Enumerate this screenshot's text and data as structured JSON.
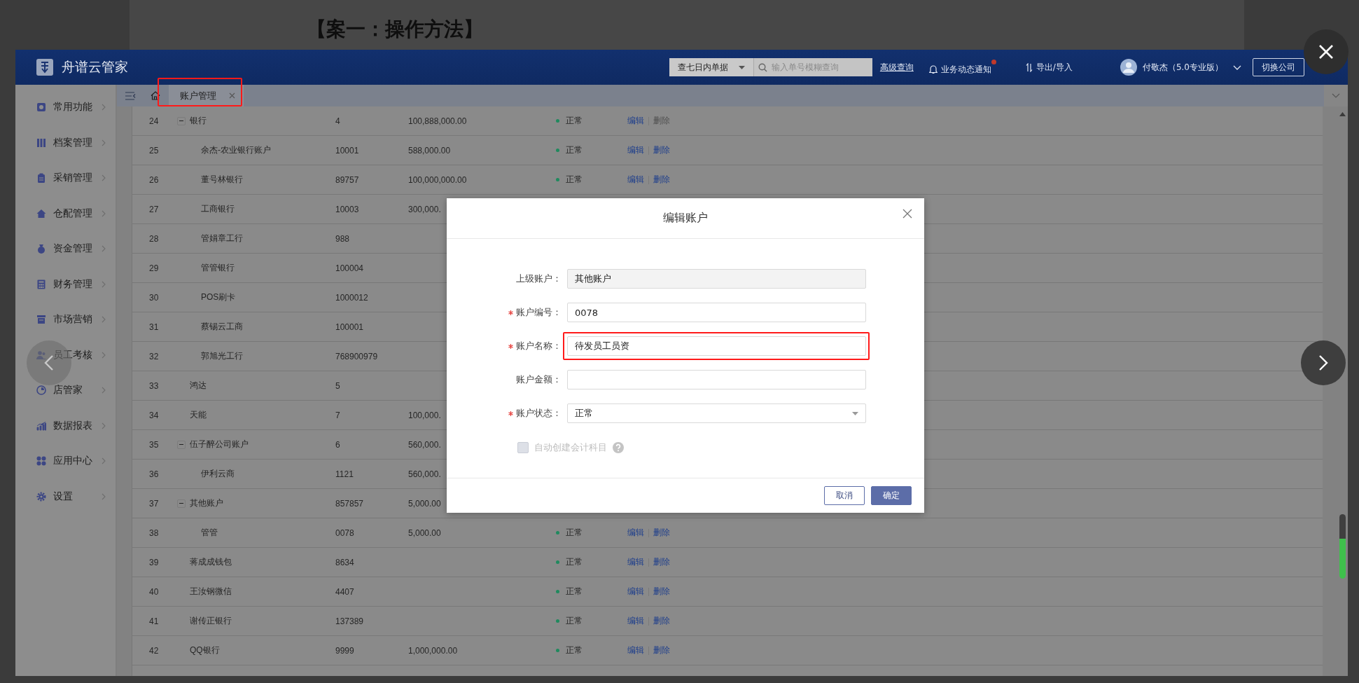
{
  "document": {
    "heading": "【案一：操作方法】"
  },
  "app": {
    "header": {
      "brand": "舟谱云管家",
      "range_select": "查七日内单据",
      "search": {
        "placeholder": "输入单号模糊查询"
      },
      "advanced_link": "高级查询",
      "notifications": {
        "label": "业务动态通知",
        "unread": true
      },
      "export_import": "导出/导入",
      "user": "付敬杰（5.0专业版）",
      "switch_button": "切换公司"
    },
    "sidebar": {
      "items": [
        {
          "label": "常用功能"
        },
        {
          "label": "档案管理"
        },
        {
          "label": "采销管理"
        },
        {
          "label": "仓配管理"
        },
        {
          "label": "资金管理"
        },
        {
          "label": "财务管理"
        },
        {
          "label": "市场营销"
        },
        {
          "label": "员工考核"
        },
        {
          "label": "店管家"
        },
        {
          "label": "数据报表"
        },
        {
          "label": "应用中心"
        },
        {
          "label": "设置"
        }
      ]
    },
    "tabs": [
      {
        "label": "账户管理",
        "selected": true,
        "highlighted": true
      }
    ],
    "table": {
      "rows": [
        {
          "no": "24",
          "name": "银行",
          "code": "4",
          "amount": "100,888,000.00",
          "status": "正常",
          "actions": [
            {
              "label": "编辑",
              "disabled": false
            },
            {
              "label": "删除",
              "disabled": true
            }
          ],
          "expanded": true,
          "children": [
            {
              "no": "25",
              "name": "余杰-农业银行账户",
              "code": "10001",
              "amount": "588,000.00",
              "status": "正常",
              "actions": [
                {
                  "label": "编辑",
                  "disabled": false
                },
                {
                  "label": "删除",
                  "disabled": false
                }
              ]
            },
            {
              "no": "26",
              "name": "董号林银行",
              "code": "89757",
              "amount": "100,000,000.00",
              "status": "正常",
              "actions": [
                {
                  "label": "编辑",
                  "disabled": false
                },
                {
                  "label": "删除",
                  "disabled": false
                }
              ]
            },
            {
              "no": "27",
              "name": "工商银行",
              "code": "10003",
              "amount": "300,000."
            },
            {
              "no": "28",
              "name": "管娟章工行",
              "code": "988"
            },
            {
              "no": "29",
              "name": "管管银行",
              "code": "100004"
            },
            {
              "no": "30",
              "name": "POS刷卡",
              "code": "1000012"
            },
            {
              "no": "31",
              "name": "蔡锡云工商",
              "code": "100001"
            },
            {
              "no": "32",
              "name": "郭旭光工行",
              "code": "768900979"
            }
          ]
        },
        {
          "no": "33",
          "name": "鸿达",
          "code": "5"
        },
        {
          "no": "34",
          "name": "天能",
          "code": "7",
          "amount": "100,000."
        },
        {
          "no": "35",
          "name": "伍子醉公司账户",
          "code": "6",
          "amount": "560,000.",
          "expanded": true,
          "children": [
            {
              "no": "36",
              "name": "伊利云商",
              "code": "1121",
              "amount": "560,000."
            }
          ]
        },
        {
          "no": "37",
          "name": "其他账户",
          "code": "857857",
          "amount": "5,000.00",
          "expanded": true,
          "children": [
            {
              "no": "38",
              "name": "管管",
              "code": "0078",
              "amount": "5,000.00",
              "status": "正常",
              "actions": [
                {
                  "label": "编辑",
                  "disabled": false
                },
                {
                  "label": "删除",
                  "disabled": false
                }
              ]
            }
          ]
        },
        {
          "no": "39",
          "name": "蒋成成钱包",
          "code": "8634",
          "status": "正常",
          "actions": [
            {
              "label": "编辑",
              "disabled": false
            },
            {
              "label": "删除",
              "disabled": false
            }
          ]
        },
        {
          "no": "40",
          "name": "王汝钢微信",
          "code": "4407",
          "status": "正常",
          "actions": [
            {
              "label": "编辑",
              "disabled": false
            },
            {
              "label": "删除",
              "disabled": false
            }
          ]
        },
        {
          "no": "41",
          "name": "谢传正银行",
          "code": "137389",
          "status": "正常",
          "actions": [
            {
              "label": "编辑",
              "disabled": false
            },
            {
              "label": "删除",
              "disabled": false
            }
          ]
        },
        {
          "no": "42",
          "name": "QQ银行",
          "code": "9999",
          "amount": "1,000,000.00",
          "status": "正常",
          "actions": [
            {
              "label": "编辑",
              "disabled": false
            },
            {
              "label": "删除",
              "disabled": false
            }
          ]
        }
      ]
    }
  },
  "dialog": {
    "title": "编辑账户",
    "fields": [
      {
        "label": "上级账户：",
        "kind": "readonly",
        "value": "其他账户"
      },
      {
        "label": "账户编号：",
        "kind": "text",
        "value": "0078",
        "required": true
      },
      {
        "label": "账户名称：",
        "kind": "text",
        "value": "待发员工员资",
        "required": true,
        "highlighted": true
      },
      {
        "label": "账户金额：",
        "kind": "text"
      },
      {
        "label": "账户状态：",
        "kind": "select",
        "value": "正常",
        "required": true
      }
    ],
    "auto_create": {
      "label": "自动创建会计科目",
      "checked": false,
      "disabled": true
    },
    "buttons": [
      {
        "label": "取消",
        "kind": "secondary"
      },
      {
        "label": "确定",
        "kind": "primary"
      }
    ]
  }
}
